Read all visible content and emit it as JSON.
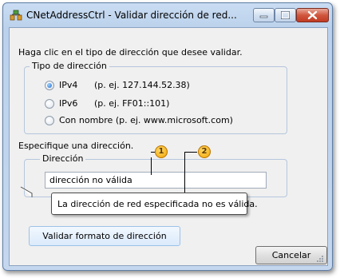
{
  "window": {
    "title": "CNetAddressCtrl - Validar dirección de red..."
  },
  "instruction": "Haga clic en el tipo de dirección que desee validar.",
  "address_type_group": {
    "legend": "Tipo de dirección",
    "options": [
      {
        "label": "IPv4",
        "example": "(p. ej. 127.144.52.38)",
        "checked": true
      },
      {
        "label": "IPv6",
        "example": "(p. ej. FF01::101)",
        "checked": false
      },
      {
        "label": "Con nombre (p. ej. www.microsoft.com)",
        "example": "",
        "checked": false
      }
    ]
  },
  "specify_label": "Especifique una dirección.",
  "address_group": {
    "legend": "Dirección",
    "value": "dirección no válida"
  },
  "tooltip": "La dirección de red especificada no es válida.",
  "buttons": {
    "validate": "Validar formato de dirección",
    "cancel": "Cancelar"
  },
  "callouts": [
    "1",
    "2"
  ],
  "icons": [
    "app-icon",
    "minimize-icon",
    "maximize-icon",
    "close-icon",
    "resize-grip-icon"
  ]
}
